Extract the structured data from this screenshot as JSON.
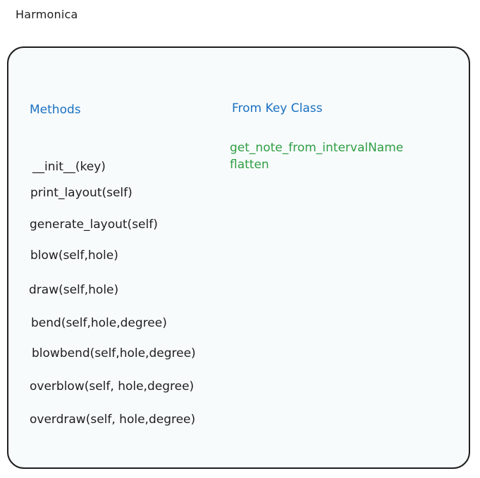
{
  "title": "Harmonica",
  "methods": {
    "heading": "Methods",
    "items": [
      "__init__(key)",
      "print_layout(self)",
      "generate_layout(self)",
      "blow(self,hole)",
      "draw(self,hole)",
      "bend(self,hole,degree)",
      "blowbend(self,hole,degree)",
      "overblow(self, hole,degree)",
      "overdraw(self, hole,degree)"
    ]
  },
  "key_class": {
    "heading": "From Key Class",
    "items": [
      "get_note_from_intervalName",
      "flatten"
    ]
  },
  "colors": {
    "heading": "#1971c2",
    "key_items": "#2f9e44",
    "text": "#1e1e1e",
    "card_background": "#f8fbfc"
  }
}
